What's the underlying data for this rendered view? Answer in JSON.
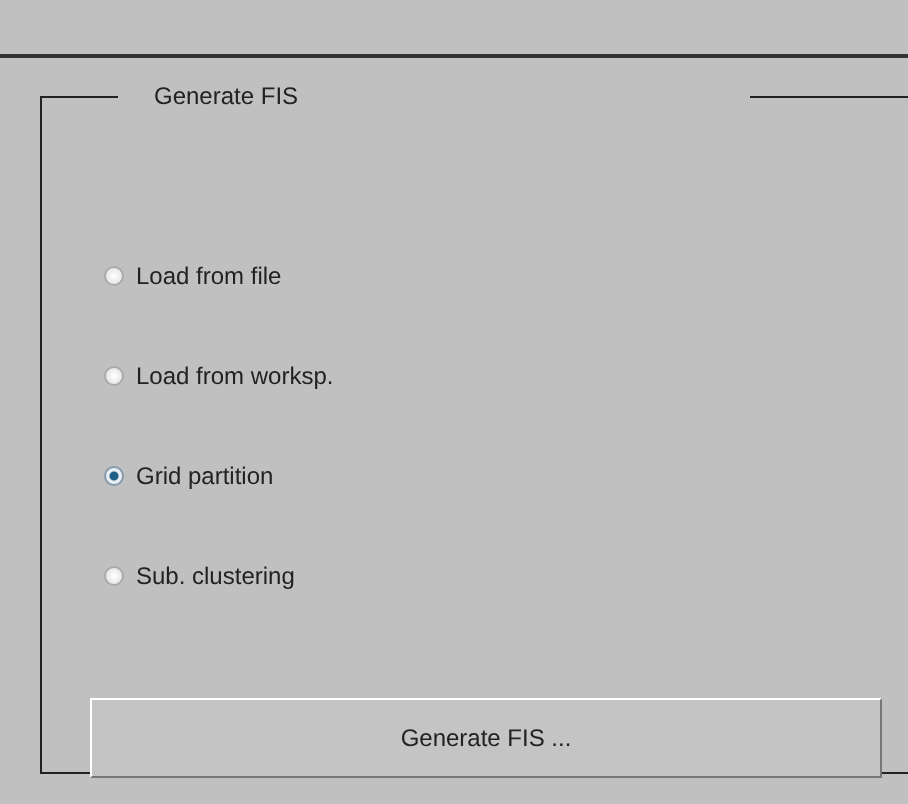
{
  "panel": {
    "title": "Generate FIS"
  },
  "options": [
    {
      "label": "Load from file",
      "selected": false
    },
    {
      "label": "Load from worksp.",
      "selected": false
    },
    {
      "label": "Grid partition",
      "selected": true
    },
    {
      "label": "Sub. clustering",
      "selected": false
    }
  ],
  "button": {
    "label": "Generate FIS ..."
  }
}
